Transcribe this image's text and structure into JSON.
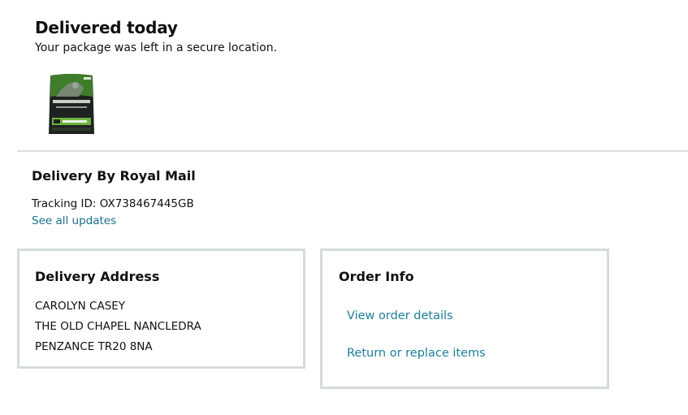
{
  "status": {
    "title": "Delivered today",
    "subtitle": "Your package was left in a secure location."
  },
  "product": {
    "image_icon": "pet-food-bag-image",
    "colors": {
      "bag": "#1e2320",
      "accent": "#6db33f"
    }
  },
  "carrier": {
    "title": "Delivery By Royal Mail",
    "tracking": "Tracking ID: OX738467445GB",
    "see_updates": "See all updates"
  },
  "address": {
    "title": "Delivery Address",
    "lines": [
      "CAROLYN CASEY",
      "THE OLD CHAPEL NANCLEDRA",
      "PENZANCE TR20 8NA"
    ]
  },
  "order_info": {
    "title": "Order Info",
    "view_details": "View order details",
    "return_replace": "Return or replace items"
  },
  "theme": {
    "link_color": "#1b7e97",
    "border_color": "#d5dbdb",
    "text_color": "#0f1111"
  }
}
